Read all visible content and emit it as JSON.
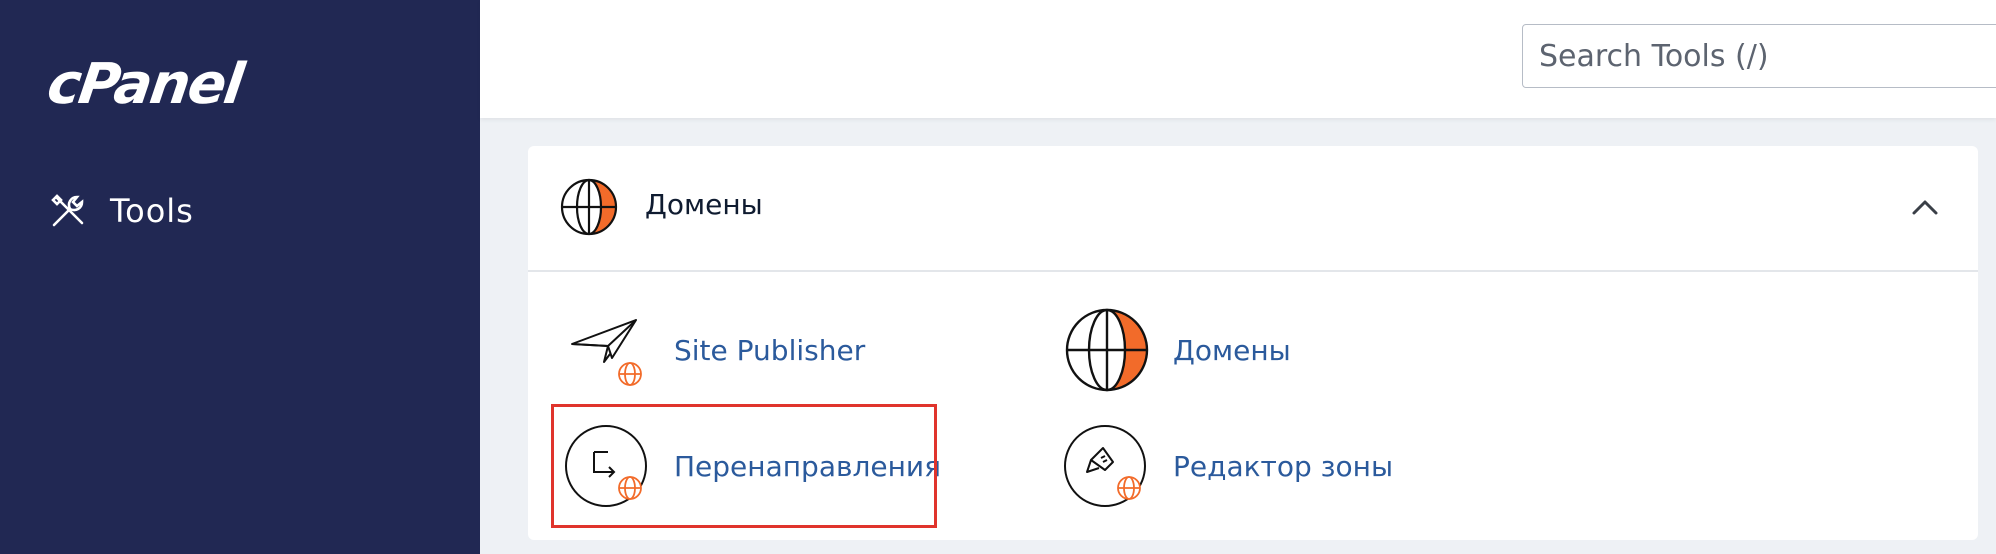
{
  "sidebar": {
    "logo_text": "cPanel",
    "items": [
      {
        "label": "Tools",
        "icon": "tools-icon"
      }
    ]
  },
  "header": {
    "search": {
      "placeholder": "Search Tools (/)",
      "value": ""
    }
  },
  "section": {
    "title": "Домены",
    "icon": "globe-icon",
    "expanded": true,
    "tools": [
      {
        "label": "Site Publisher",
        "icon": "site-publisher-icon"
      },
      {
        "label": "Домены",
        "icon": "domains-globe-icon"
      },
      {
        "label": "Перенаправления",
        "icon": "redirects-icon"
      },
      {
        "label": "Редактор зоны",
        "icon": "zone-editor-icon"
      }
    ]
  },
  "colors": {
    "sidebar_bg": "#212853",
    "accent_orange": "#f26b2a",
    "link_blue": "#2b5a9c",
    "highlight_red": "#e0342c"
  }
}
